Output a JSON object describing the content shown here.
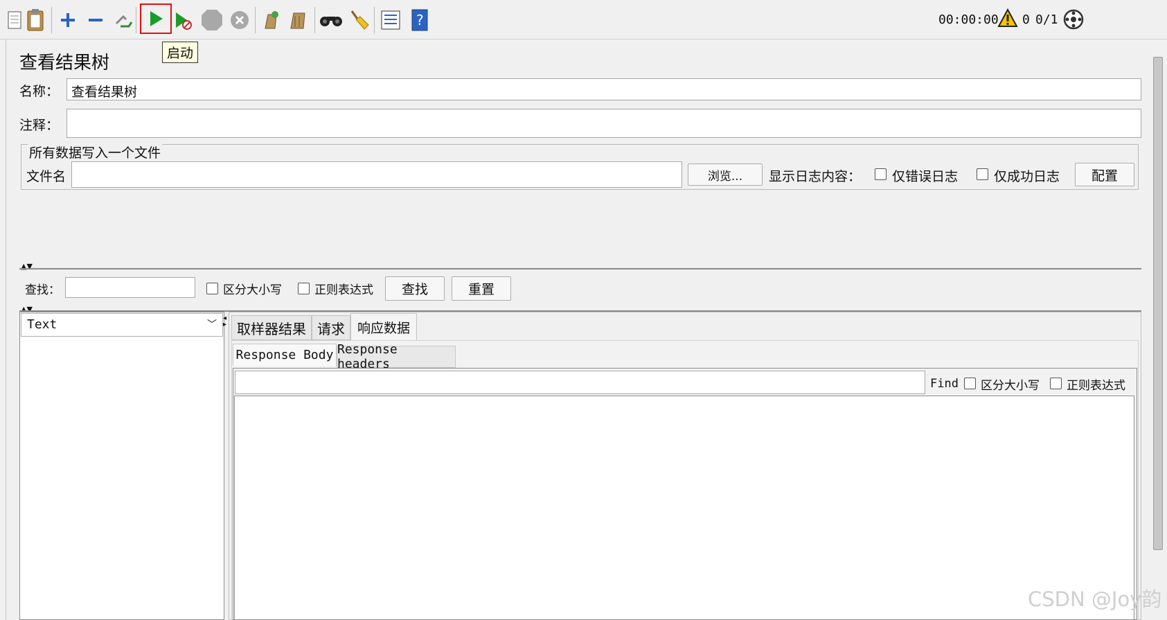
{
  "toolbar": {
    "start_tooltip": "启动",
    "timer": "00:00:00",
    "warning_count": "0",
    "thread_count": "0/1",
    "icons": [
      "new-icon",
      "paste-icon",
      "add-icon",
      "remove-icon",
      "toggle-icon",
      "start-icon",
      "start-no-pause-icon",
      "stop-icon",
      "shutdown-icon",
      "clear-icon",
      "clear-all-icon",
      "search-binoculars-icon",
      "reset-broom-icon",
      "function-helper-icon",
      "help-icon",
      "warning-icon",
      "remote-icon"
    ]
  },
  "panel": {
    "title": "查看结果树",
    "name_label": "名称：",
    "name_value": "查看结果树",
    "comment_label": "注释：",
    "comment_value": ""
  },
  "file_group": {
    "legend": "所有数据写入一个文件",
    "filename_label": "文件名",
    "filename_value": "",
    "browse_label": "浏览...",
    "log_content_label": "显示日志内容：",
    "errors_only_label": "仅错误日志",
    "success_only_label": "仅成功日志",
    "configure_label": "配置"
  },
  "search": {
    "label": "查找：",
    "value": "",
    "case_sensitive_label": "区分大小写",
    "regex_label": "正则表达式",
    "find_label": "查找",
    "reset_label": "重置"
  },
  "renderer": {
    "selected": "Text"
  },
  "result_tabs": [
    {
      "label": "取样器结果"
    },
    {
      "label": "请求"
    },
    {
      "label": "响应数据"
    }
  ],
  "response_subtabs": [
    {
      "label": "Response Body"
    },
    {
      "label": "Response headers"
    }
  ],
  "response_find": {
    "value": "",
    "find_label": "Find",
    "case_sensitive_label": "区分大小写",
    "regex_label": "正则表达式"
  },
  "watermark": "CSDN @Joy韵",
  "colors": {
    "highlight_border": "#e01010",
    "tooltip_bg": "#ffffe1",
    "run_green": "#1a9c2a"
  }
}
